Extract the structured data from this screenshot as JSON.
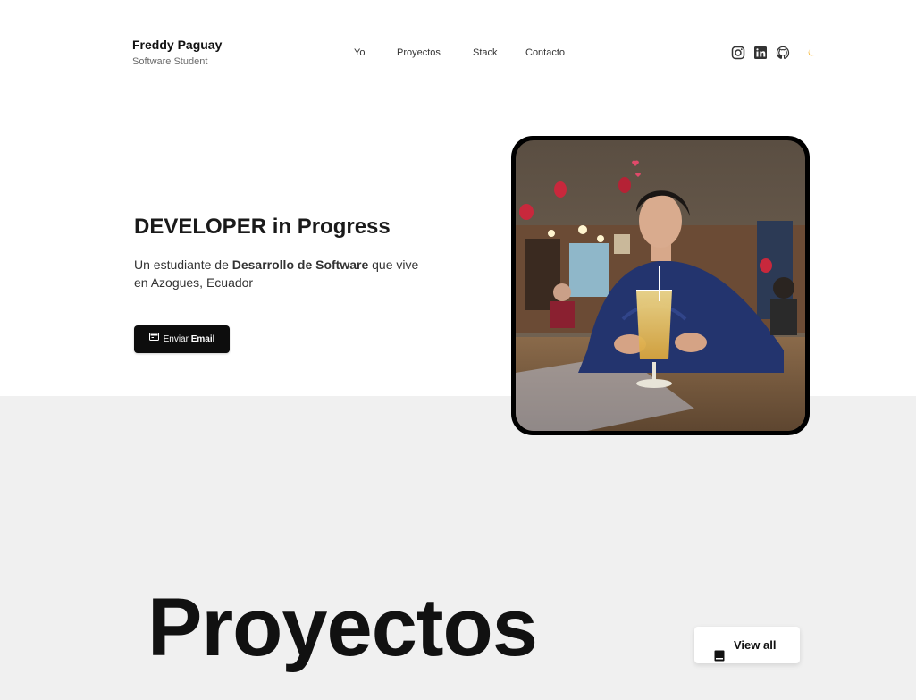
{
  "header": {
    "brand_name": "Freddy Paguay",
    "brand_sub": "Software Student",
    "nav": [
      {
        "label": "Yo"
      },
      {
        "label": "Proyectos"
      },
      {
        "label": "Stack"
      },
      {
        "label": "Contacto"
      }
    ],
    "socials": [
      {
        "icon": "instagram-icon"
      },
      {
        "icon": "linkedin-icon"
      },
      {
        "icon": "github-icon"
      },
      {
        "icon": "moon-icon"
      }
    ]
  },
  "hero": {
    "title_strong": "DEVELOPER",
    "title_rest": " in Progress",
    "desc_pre": "Un estudiante de ",
    "desc_strong": "Desarrollo de Software",
    "desc_post": " que vive en Azogues, Ecuador",
    "email_button_pre": "Enviar ",
    "email_button_bold": "Email",
    "photo_icon": "profile-photo"
  },
  "projects": {
    "title": "Proyectos",
    "view_all": "View all",
    "view_all_icon": "book-icon"
  },
  "colors": {
    "accent_moon": "#f5a400",
    "button_dark": "#0d0d0d",
    "section_bg": "#f0f0f0"
  }
}
